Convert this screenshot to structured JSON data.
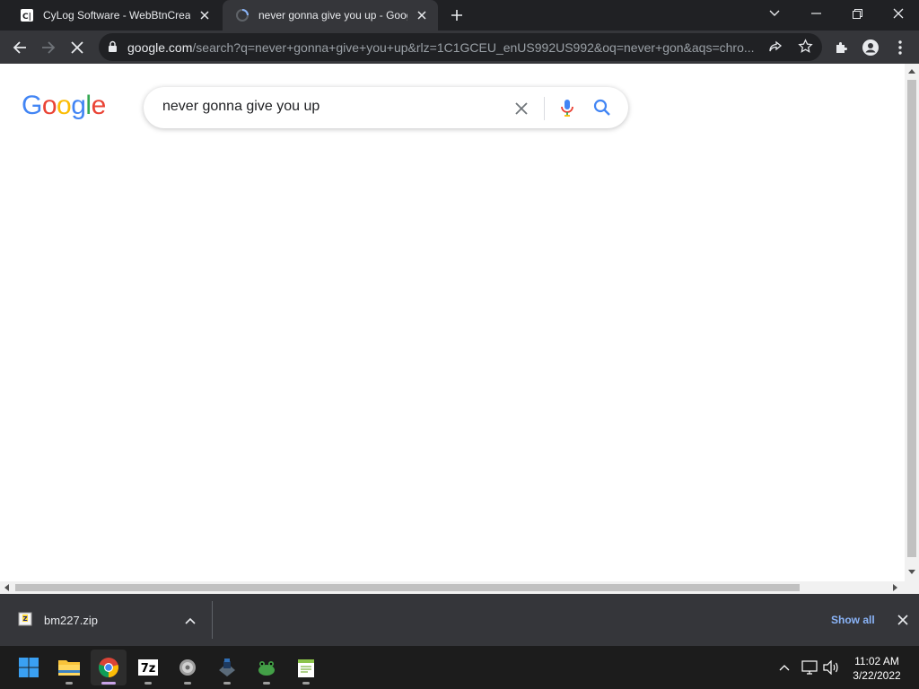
{
  "browser": {
    "tabs": [
      {
        "title": "CyLog Software - WebBtnCreator",
        "favicon": "cylog-icon",
        "active": false
      },
      {
        "title": "never gonna give you up - Google Search",
        "favicon": "loading-spinner-icon",
        "active": true
      }
    ],
    "url_host": "google.com",
    "url_path": "/search?q=never+gonna+give+you+up&rlz=1C1GCEU_enUS992US992&oq=never+gon&aqs=chro..."
  },
  "google": {
    "logo": [
      "G",
      "o",
      "o",
      "g",
      "l",
      "e"
    ],
    "logo_colors": [
      "#4285f4",
      "#ea4335",
      "#fbbc05",
      "#4285f4",
      "#34a853",
      "#ea4335"
    ],
    "query": "never gonna give you up"
  },
  "downloads": {
    "file_name": "bm227.zip",
    "file_icon": "zip-archive-icon",
    "show_all_label": "Show all"
  },
  "taskbar": {
    "apps": [
      "start-button",
      "file-explorer-icon",
      "chrome-icon",
      "7zip-icon",
      "settings-icon",
      "app-icon",
      "frog-app-icon",
      "notepad-icon"
    ],
    "time": "11:02 AM",
    "date": "3/22/2022"
  },
  "colors": {
    "tabstrip_bg": "#202124",
    "toolbar_bg": "#35363a",
    "link_blue": "#8ab4f8"
  }
}
